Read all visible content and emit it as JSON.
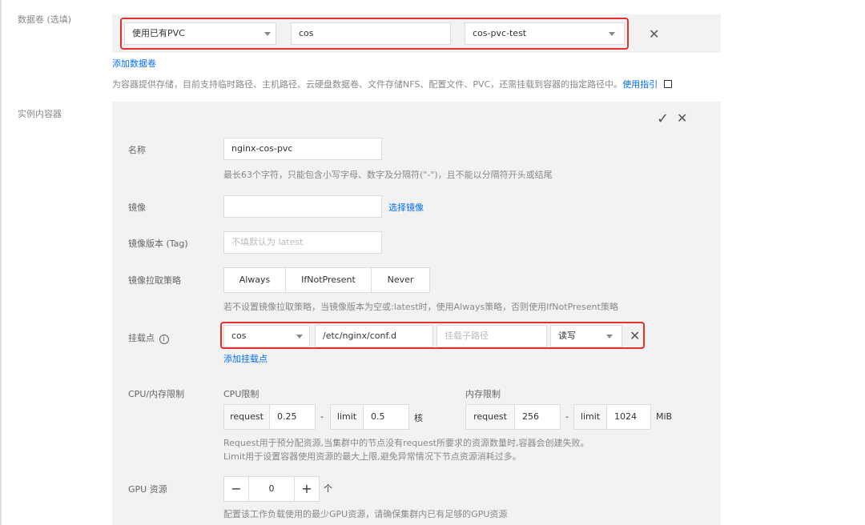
{
  "volume": {
    "label": "数据卷 (选填)",
    "type_value": "使用已有PVC",
    "name_value": "cos",
    "pvc_value": "cos-pvc-test",
    "add_link": "添加数据卷",
    "hint": "为容器提供存储，目前支持临时路径、主机路径、云硬盘数据卷、文件存储NFS、配置文件、PVC，还需挂载到容器的指定路径中。",
    "guide_link": "使用指引"
  },
  "container": {
    "label": "实例内容器",
    "name": {
      "label": "名称",
      "value": "nginx-cos-pvc",
      "hint": "最长63个字符，只能包含小写字母、数字及分隔符(\"-\")，且不能以分隔符开头或结尾"
    },
    "image": {
      "label": "镜像",
      "value": "",
      "select_link": "选择镜像"
    },
    "tag": {
      "label": "镜像版本 (Tag)",
      "placeholder": "不填默认为 latest"
    },
    "pull_policy": {
      "label": "镜像拉取策略",
      "options": [
        "Always",
        "IfNotPresent",
        "Never"
      ],
      "hint": "若不设置镜像拉取策略，当镜像版本为空或:latest时，使用Always策略，否则使用IfNotPresent策略"
    },
    "mount": {
      "label": "挂载点",
      "volume_value": "cos",
      "path_value": "/etc/nginx/conf.d",
      "subpath_placeholder": "挂载子路径",
      "mode_value": "读写",
      "add_link": "添加挂载点"
    },
    "resources": {
      "label": "CPU/内存限制",
      "cpu_title": "CPU限制",
      "mem_title": "内存限制",
      "request_label": "request",
      "limit_label": "limit",
      "dash": "-",
      "cpu_request": "0.25",
      "cpu_limit": "0.5",
      "cpu_unit": "核",
      "mem_request": "256",
      "mem_limit": "1024",
      "mem_unit": "MiB",
      "hint1": "Request用于预分配资源,当集群中的节点没有request所要求的资源数量时,容器会创建失败。",
      "hint2": "Limit用于设置容器使用资源的最大上限,避免异常情况下节点资源消耗过多。"
    },
    "gpu": {
      "label": "GPU 资源",
      "minus": "−",
      "value": "0",
      "plus": "+",
      "unit": "个",
      "hint": "配置该工作负载使用的最少GPU资源，请确保集群内已有足够的GPU资源"
    }
  }
}
